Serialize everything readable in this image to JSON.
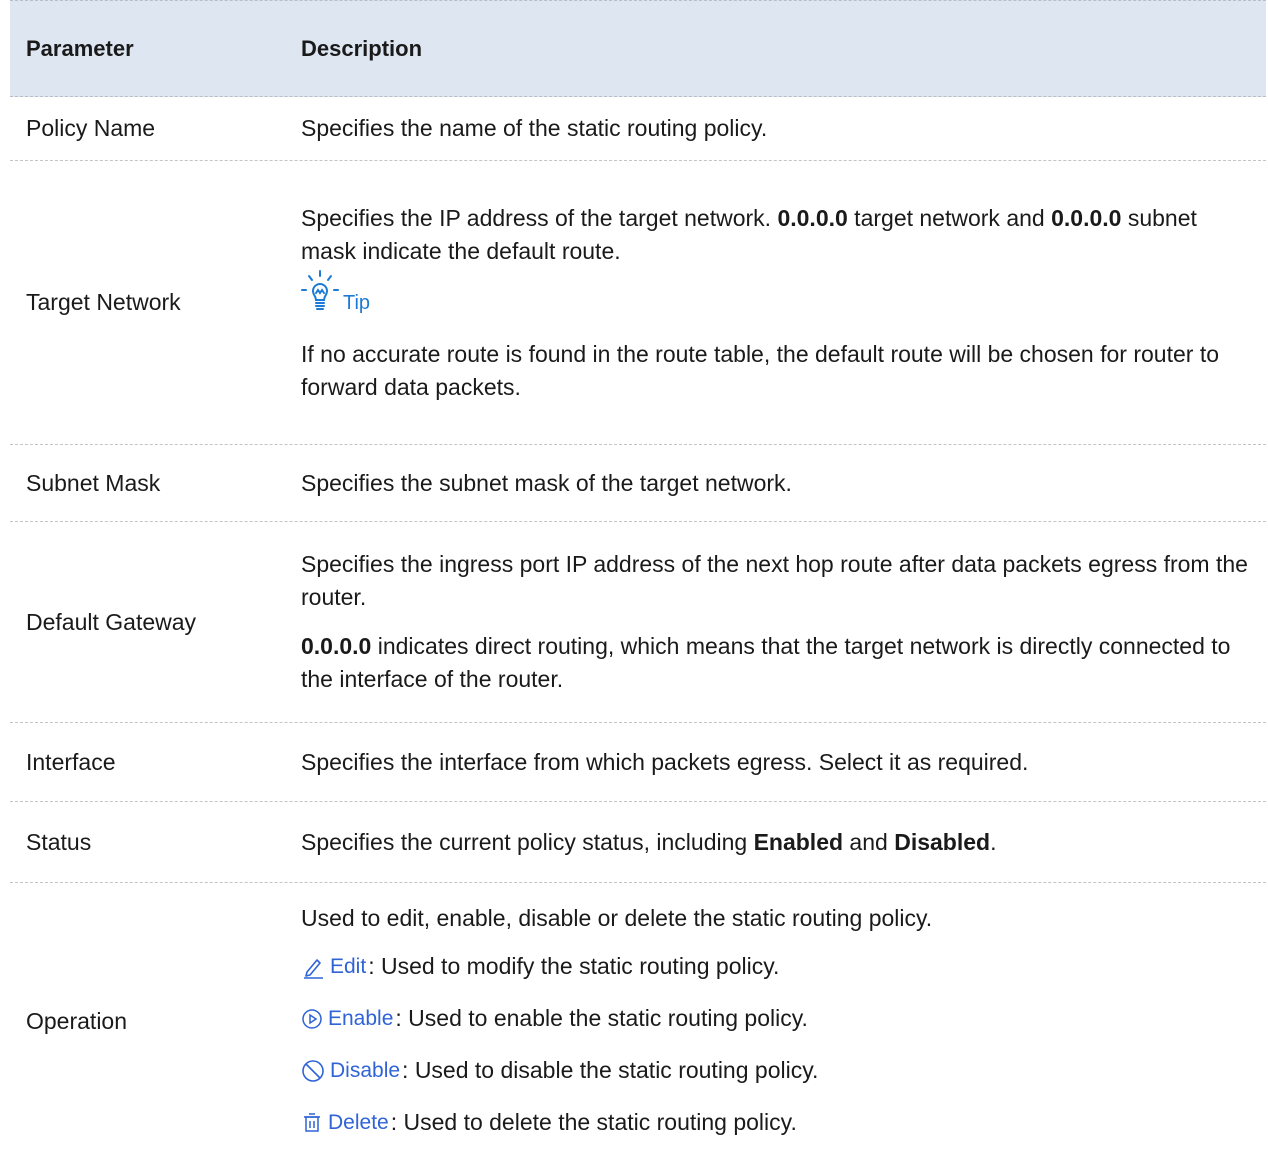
{
  "table": {
    "headers": {
      "parameter": "Parameter",
      "description": "Description"
    },
    "rows": {
      "policy_name": {
        "parameter": "Policy Name",
        "description": "Specifies the name of the static routing policy."
      },
      "target_network": {
        "parameter": "Target Network",
        "desc_part1": "Specifies the IP address of the target network. ",
        "desc_bold1": "0.0.0.0",
        "desc_part2": " target network and ",
        "desc_bold2": "0.0.0.0",
        "desc_part3": " subnet mask indicate the default route.",
        "tip_label": "Tip",
        "tip_text": "If no accurate route is found in the route table, the default route will be chosen for router to forward data packets."
      },
      "subnet_mask": {
        "parameter": "Subnet Mask",
        "description": "Specifies the subnet mask of the target network."
      },
      "default_gateway": {
        "parameter": "Default Gateway",
        "description": "Specifies the ingress port IP address of the next hop route after data packets egress from the router.",
        "desc2_bold": "0.0.0.0",
        "desc2_rest": " indicates direct routing, which means that the target network is directly connected to the interface of the router."
      },
      "interface": {
        "parameter": "Interface",
        "description": "Specifies the interface from which packets egress. Select it as required."
      },
      "status": {
        "parameter": "Status",
        "desc_part1": "Specifies the current policy status, including ",
        "desc_bold1": "Enabled",
        "desc_part2": " and ",
        "desc_bold2": "Disabled",
        "desc_part3": "."
      },
      "operation": {
        "parameter": "Operation",
        "description": "Used to edit, enable, disable or delete the static routing policy.",
        "items": {
          "edit": {
            "label": "Edit",
            "text": ": Used to modify the static routing policy.",
            "icon": "pencil-icon"
          },
          "enable": {
            "label": "Enable",
            "text": ": Used to enable the static routing policy.",
            "icon": "play-circle-icon"
          },
          "disable": {
            "label": "Disable",
            "text": ": Used to disable the static routing policy.",
            "icon": "ban-icon"
          },
          "delete": {
            "label": "Delete",
            "text": ": Used to delete the static routing policy.",
            "icon": "trash-icon"
          }
        }
      }
    }
  },
  "colors": {
    "header_bg": "#dde6f1",
    "link_blue": "#2f63d6",
    "tip_blue": "#1c7bd6"
  }
}
